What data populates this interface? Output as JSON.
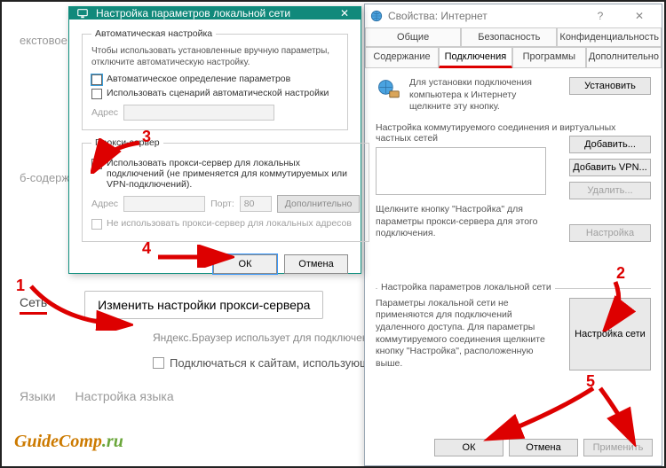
{
  "background": {
    "text_hint_1": "екстовое м",
    "text_hint_2": "б-содержи",
    "network_label": "Сеть",
    "proxy_button": "Изменить настройки прокси-сервера",
    "subtext": "Яндекс.Браузер использует для подключения к с",
    "checkbox_label": "Подключаться к сайтам, использующи",
    "lang_label": "Языки",
    "lang_button": "Настройка языка",
    "watermark_1": "GuideComp",
    "watermark_2": ".ru"
  },
  "ip": {
    "title": "Свойства: Интернет",
    "tabs": {
      "r1": [
        "Общие",
        "Безопасность",
        "Конфиденциальность"
      ],
      "r2": [
        "Содержание",
        "Подключения",
        "Программы",
        "Дополнительно"
      ],
      "active": "Подключения"
    },
    "setup_text": "Для установки подключения компьютера к Интернету щелкните эту кнопку.",
    "btn_setup": "Установить",
    "dialup_label": "Настройка коммутируемого соединения и виртуальных частных сетей",
    "btn_add": "Добавить...",
    "btn_add_vpn": "Добавить VPN...",
    "btn_remove": "Удалить...",
    "btn_settings": "Настройка",
    "dialup_note": "Щелкните кнопку \"Настройка\" для параметры прокси-сервера для этого подключения.",
    "lan_legend": "Настройка параметров локальной сети",
    "lan_text": "Параметры локальной сети не применяются для подключений удаленного доступа. Для параметры коммутируемого соединения щелкните кнопку \"Настройка\", расположенную выше.",
    "btn_lan": "Настройка сети",
    "btn_ok": "ОК",
    "btn_cancel": "Отмена",
    "btn_apply": "Применить"
  },
  "lan": {
    "title": "Настройка параметров локальной сети",
    "auto_legend": "Автоматическая настройка",
    "auto_note": "Чтобы использовать установленные вручную параметры, отключите автоматическую настройку.",
    "chk_auto_detect": "Автоматическое определение параметров",
    "chk_auto_script": "Использовать сценарий автоматической настройки",
    "addr_label": "Адрес",
    "proxy_legend": "Прокси-сервер",
    "chk_use_proxy": "Использовать прокси-сервер для локальных подключений (не применяется для коммутируемых или VPN-подключений).",
    "port_label": "Порт:",
    "port_value": "80",
    "btn_advanced": "Дополнительно",
    "chk_bypass": "Не использовать прокси-сервер для локальных адресов",
    "btn_ok": "ОК",
    "btn_cancel": "Отмена"
  },
  "annot": {
    "n1": "1",
    "n2": "2",
    "n3": "3",
    "n4": "4",
    "n5": "5"
  }
}
